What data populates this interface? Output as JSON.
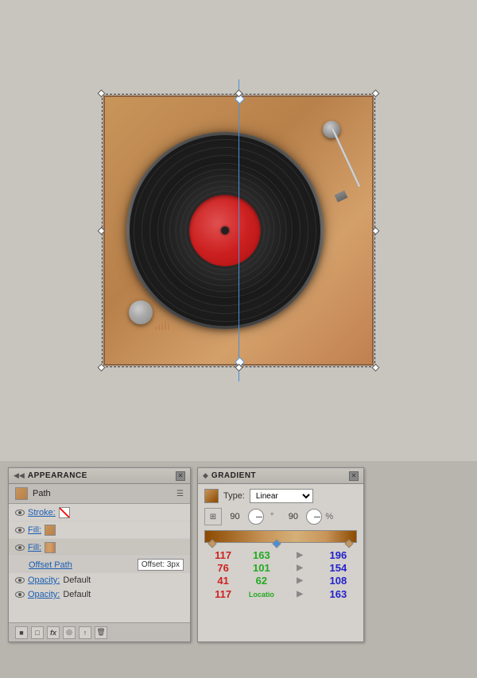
{
  "canvas": {
    "background": "#c8c4be"
  },
  "appearance_panel": {
    "title": "APPEARANCE",
    "path_label": "Path",
    "stroke_label": "Stroke:",
    "fill_label": "Fill:",
    "fill_gradient_label": "Fill:",
    "offset_path_label": "Offset Path",
    "offset_value": "Offset: 3px",
    "opacity_label1": "Opacity:",
    "opacity_value1": "Default",
    "opacity_label2": "Opacity:",
    "opacity_value2": "Default",
    "toolbar_icons": [
      "square",
      "square-outline",
      "fx",
      "circle",
      "bars",
      "trash"
    ]
  },
  "gradient_panel": {
    "title": "GRADIENT",
    "type_label": "Type:",
    "type_value": "Linear",
    "angle_value": "90",
    "location_value": "90",
    "percent": "%",
    "color_values": {
      "row1_r": "117",
      "row1_g": "163",
      "row1_b1": "163",
      "row1_b2": "196",
      "row2_r": "76",
      "row2_g": "101",
      "row2_b1": "101",
      "row2_b2": "154",
      "row3_r": "41",
      "row3_g": "62",
      "row3_b1": "62",
      "row3_b2": "108"
    }
  }
}
